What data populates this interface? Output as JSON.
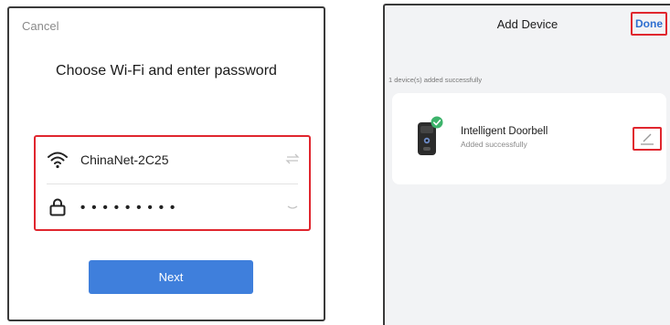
{
  "wifi_screen": {
    "cancel_label": "Cancel",
    "heading": "Choose Wi-Fi and enter password",
    "network": {
      "icon": "wifi-icon",
      "value": "ChinaNet-2C25",
      "action_icon": "switch-network-icon"
    },
    "password": {
      "icon": "lock-icon",
      "value": "•••••••••",
      "action_icon": "toggle-visibility-icon"
    },
    "next_label": "Next",
    "accent_color": "#3f7fdc",
    "highlight_color": "#e0262e"
  },
  "add_device_screen": {
    "title": "Add Device",
    "done_label": "Done",
    "status_text": "1 device(s) added successfully",
    "device": {
      "icon": "doorbell-icon",
      "badge_icon": "check-icon",
      "name": "Intelligent Doorbell",
      "status": "Added successfully",
      "edit_icon": "edit-icon"
    },
    "link_color": "#2e6fd0",
    "success_color": "#3db36b"
  }
}
